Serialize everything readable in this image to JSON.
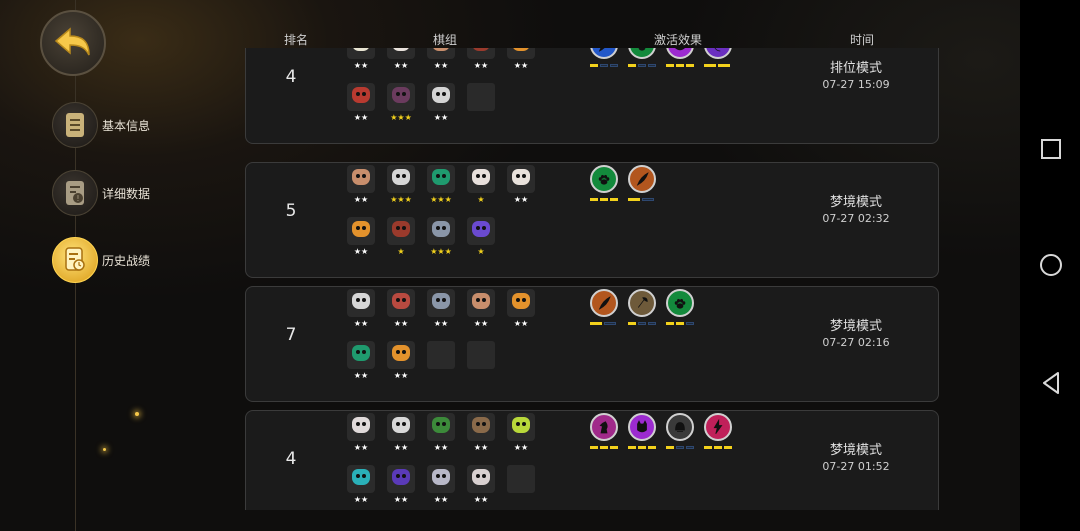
{
  "nav": {
    "items": [
      {
        "label": "基本信息",
        "icon": "scroll-icon"
      },
      {
        "label": "详细数据",
        "icon": "data-sheet-icon"
      },
      {
        "label": "历史战绩",
        "icon": "history-record-icon"
      }
    ],
    "active_index": 2
  },
  "columns": {
    "rank": "排名",
    "lineup": "棋组",
    "synergy": "激活效果",
    "time": "时间"
  },
  "colors": {
    "gold": "#f2d11c",
    "accent": "#ffd451",
    "panel": "#1b1b1b"
  },
  "matches": [
    {
      "rank": "4",
      "mode": "排位模式",
      "time": "07-27 15:09",
      "units": [
        {
          "stars": "★★",
          "star_color": "#ffffff",
          "color": "#e8e4d2"
        },
        {
          "stars": "★★",
          "star_color": "#ffffff",
          "color": "#e9e2dc"
        },
        {
          "stars": "★★",
          "star_color": "#ffffff",
          "color": "#c88e6c"
        },
        {
          "stars": "★★",
          "star_color": "#ffffff",
          "color": "#9a3a2c"
        },
        {
          "stars": "★★",
          "star_color": "#ffffff",
          "color": "#e3922c"
        },
        {
          "stars": "★★",
          "star_color": "#ffffff",
          "color": "#b83a30"
        },
        {
          "stars": "★★★",
          "star_color": "#f2d11c",
          "color": "#6b3b5e"
        },
        {
          "stars": "★★",
          "star_color": "#ffffff",
          "color": "#d4d4d4"
        },
        {
          "stars": "",
          "star_color": "#ffffff",
          "color": "empty"
        }
      ],
      "synergies": [
        {
          "icon": "feather-icon",
          "bg": "#2358c9",
          "active": 1,
          "total": 3
        },
        {
          "icon": "paw-icon",
          "bg": "#138a3c",
          "active": 1,
          "total": 3
        },
        {
          "icon": "demon-icon",
          "bg": "#9c2bd0",
          "active": 3,
          "total": 3
        },
        {
          "icon": "moon-icon",
          "bg": "#6a2fc0",
          "active": 2,
          "total": 2
        }
      ]
    },
    {
      "rank": "5",
      "mode": "梦境模式",
      "time": "07-27 02:32",
      "units": [
        {
          "stars": "★★",
          "star_color": "#ffffff",
          "color": "#c88e6c"
        },
        {
          "stars": "★★★",
          "star_color": "#f2d11c",
          "color": "#d6d6d6"
        },
        {
          "stars": "★★★",
          "star_color": "#f2d11c",
          "color": "#1f9a6e"
        },
        {
          "stars": "★",
          "star_color": "#f2d11c",
          "color": "#e8e0dc"
        },
        {
          "stars": "★★",
          "star_color": "#ffffff",
          "color": "#e9e2dc"
        },
        {
          "stars": "★★",
          "star_color": "#ffffff",
          "color": "#e3922c"
        },
        {
          "stars": "★",
          "star_color": "#f2d11c",
          "color": "#9a3a2c"
        },
        {
          "stars": "★★★",
          "star_color": "#f2d11c",
          "color": "#8a96a8"
        },
        {
          "stars": "★",
          "star_color": "#f2d11c",
          "color": "#6a4ad0"
        }
      ],
      "synergies": [
        {
          "icon": "paw-icon",
          "bg": "#138a3c",
          "active": 3,
          "total": 3
        },
        {
          "icon": "feather-icon",
          "bg": "#b2561e",
          "active": 1,
          "total": 2
        }
      ]
    },
    {
      "rank": "7",
      "mode": "梦境模式",
      "time": "07-27 02:16",
      "units": [
        {
          "stars": "★★",
          "star_color": "#ffffff",
          "color": "#d6d6d6"
        },
        {
          "stars": "★★",
          "star_color": "#ffffff",
          "color": "#b84a40"
        },
        {
          "stars": "★★",
          "star_color": "#ffffff",
          "color": "#8a96a8"
        },
        {
          "stars": "★★",
          "star_color": "#ffffff",
          "color": "#c88e6c"
        },
        {
          "stars": "★★",
          "star_color": "#ffffff",
          "color": "#e3922c"
        },
        {
          "stars": "★★",
          "star_color": "#ffffff",
          "color": "#1f9a6e"
        },
        {
          "stars": "★★",
          "star_color": "#ffffff",
          "color": "#e3922c"
        },
        {
          "stars": "",
          "star_color": "#ffffff",
          "color": "empty"
        },
        {
          "stars": "",
          "star_color": "#ffffff",
          "color": "empty"
        }
      ],
      "synergies": [
        {
          "icon": "feather-icon",
          "bg": "#b2561e",
          "active": 1,
          "total": 2
        },
        {
          "icon": "axe-icon",
          "bg": "#6e5a3a",
          "active": 1,
          "total": 3
        },
        {
          "icon": "paw-icon",
          "bg": "#138a3c",
          "active": 2,
          "total": 3
        }
      ]
    },
    {
      "rank": "4",
      "mode": "梦境模式",
      "time": "07-27 01:52",
      "units": [
        {
          "stars": "★★",
          "star_color": "#ffffff",
          "color": "#e0dada"
        },
        {
          "stars": "★★",
          "star_color": "#ffffff",
          "color": "#d8d8d8"
        },
        {
          "stars": "★★",
          "star_color": "#ffffff",
          "color": "#3c8a3a"
        },
        {
          "stars": "★★",
          "star_color": "#ffffff",
          "color": "#8a6a4a"
        },
        {
          "stars": "★★",
          "star_color": "#ffffff",
          "color": "#b8d83a"
        },
        {
          "stars": "★★",
          "star_color": "#ffffff",
          "color": "#2ab0b8"
        },
        {
          "stars": "★★",
          "star_color": "#ffffff",
          "color": "#5a3ab8"
        },
        {
          "stars": "★★",
          "star_color": "#ffffff",
          "color": "#b8b8c8"
        },
        {
          "stars": "★★",
          "star_color": "#ffffff",
          "color": "#d8d0d0"
        },
        {
          "stars": "",
          "star_color": "#ffffff",
          "color": "empty"
        }
      ],
      "synergies": [
        {
          "icon": "knight-icon",
          "bg": "#a02a8a",
          "active": 3,
          "total": 3
        },
        {
          "icon": "demon-icon",
          "bg": "#9c2bd0",
          "active": 3,
          "total": 3
        },
        {
          "icon": "helmet-icon",
          "bg": "#3a3a3a",
          "active": 1,
          "total": 3
        },
        {
          "icon": "lightning-icon",
          "bg": "#c0205a",
          "active": 3,
          "total": 3
        }
      ]
    }
  ],
  "system_nav": [
    {
      "icon": "recent-apps-square-icon"
    },
    {
      "icon": "home-circle-icon"
    },
    {
      "icon": "back-triangle-icon"
    }
  ]
}
